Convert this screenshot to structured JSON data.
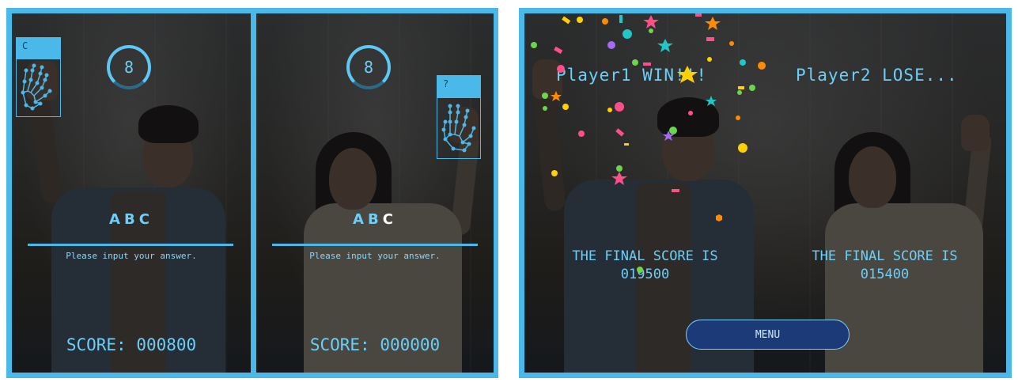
{
  "game": {
    "players": [
      {
        "letters": [
          "A",
          "B",
          "C"
        ],
        "highlight": -1,
        "prompt": "Please input your answer.",
        "score": "SCORE: 000800",
        "timer": "8",
        "detected_letter": "C"
      },
      {
        "letters": [
          "A",
          "B",
          "C"
        ],
        "highlight": 2,
        "prompt": "Please input your answer.",
        "score": "SCORE: 000000",
        "timer": "8",
        "detected_letter": "?"
      }
    ]
  },
  "result": {
    "p1_status": "Player1 WIN!!!",
    "p2_status": "Player2 LOSE...",
    "final_label": "THE FINAL SCORE IS",
    "p1_final": "019500",
    "p2_final": "015400",
    "menu_label": "MENU"
  },
  "colors": {
    "accent": "#4ab8e8",
    "text": "#6ccff7",
    "button": "#1c3a78"
  },
  "icons": [
    "hand-landmark-icon"
  ]
}
